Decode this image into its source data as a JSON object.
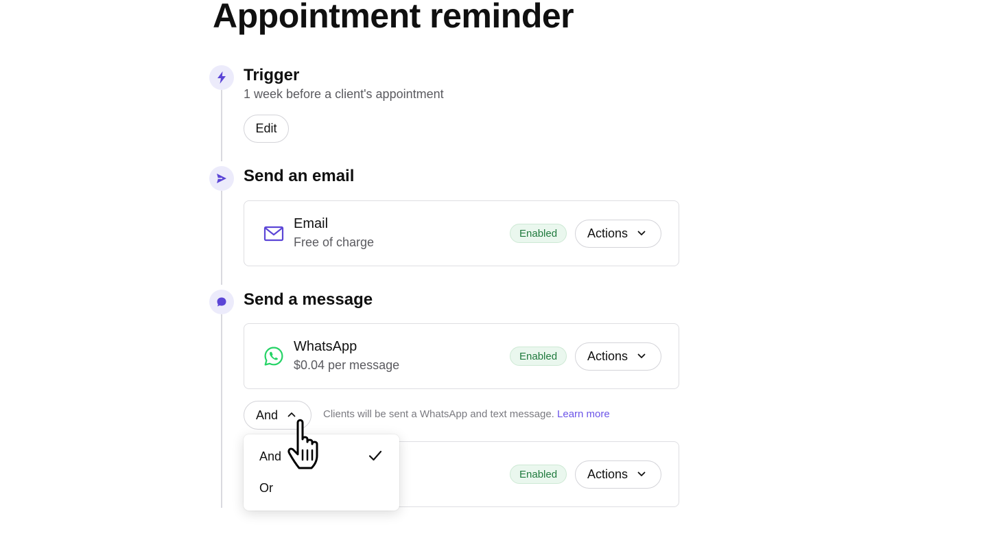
{
  "page": {
    "title": "Appointment reminder"
  },
  "trigger": {
    "title": "Trigger",
    "subtitle": "1 week before a client's appointment",
    "edit_label": "Edit",
    "icon": "lightning-icon"
  },
  "email_step": {
    "title": "Send an email",
    "icon": "send-icon",
    "card": {
      "name": "Email",
      "price": "Free of charge",
      "status": "Enabled",
      "actions_label": "Actions",
      "icon": "envelope-icon"
    }
  },
  "message_step": {
    "title": "Send a message",
    "icon": "chat-bubble-icon",
    "whatsapp_card": {
      "name": "WhatsApp",
      "price": "$0.04 per message",
      "status": "Enabled",
      "actions_label": "Actions",
      "icon": "whatsapp-icon"
    },
    "combinator": {
      "selected": "And",
      "hint": "Clients will be sent a WhatsApp and text message.",
      "learn_more": "Learn more",
      "options": [
        "And",
        "Or"
      ]
    },
    "second_card": {
      "status": "Enabled",
      "actions_label": "Actions"
    }
  },
  "colors": {
    "accent": "#6b54e8",
    "step_dot_bg": "#ecebfb",
    "enabled_bg": "#eaf7ee",
    "enabled_text": "#1f7a3d",
    "whatsapp_green": "#25d366"
  }
}
